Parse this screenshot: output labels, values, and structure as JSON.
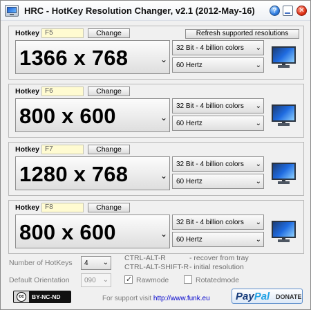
{
  "window": {
    "title": "HRC - HotKey Resolution Changer, v2.1 (2012-May-16)",
    "help_icon_glyph": "?",
    "close_icon_glyph": "✕"
  },
  "common": {
    "hotkey_label": "Hotkey",
    "change_label": "Change",
    "refresh_label": "Refresh supported resolutions",
    "arrow_glyph": "⌄"
  },
  "profiles": [
    {
      "hotkey": "F5",
      "resolution": "1366 x 768",
      "color_depth": "32 Bit - 4 billion colors",
      "refresh_rate": "60 Hertz"
    },
    {
      "hotkey": "F6",
      "resolution": "800 x 600",
      "color_depth": "32 Bit - 4 billion colors",
      "refresh_rate": "60 Hertz"
    },
    {
      "hotkey": "F7",
      "resolution": "1280 x 768",
      "color_depth": "32 Bit - 4 billion colors",
      "refresh_rate": "60 Hertz"
    },
    {
      "hotkey": "F8",
      "resolution": "800 x 600",
      "color_depth": "32 Bit - 4 billion colors",
      "refresh_rate": "60 Hertz"
    }
  ],
  "settings": {
    "number_of_hotkeys_label": "Number of HotKeys",
    "number_of_hotkeys_value": "4",
    "default_orientation_label": "Default Orientation",
    "default_orientation_value": "090",
    "shortcut_1": "CTRL-ALT-R",
    "shortcut_1_desc": "- recover from tray",
    "shortcut_2": "CTRL-ALT-SHIFT-R",
    "shortcut_2_desc": "- initial resolution",
    "rawmode_label": "Rawmode",
    "rawmode_checked": true,
    "rotatedmode_label": "Rotatedmode",
    "rotatedmode_checked": false
  },
  "footer": {
    "license_cc": "cc",
    "license_text": "BY-NC-ND",
    "support_text": "For support visit",
    "support_link": "http://www.funk.eu",
    "paypal_text_1": "Pay",
    "paypal_text_2": "Pal",
    "donate_label": "DONATE"
  }
}
